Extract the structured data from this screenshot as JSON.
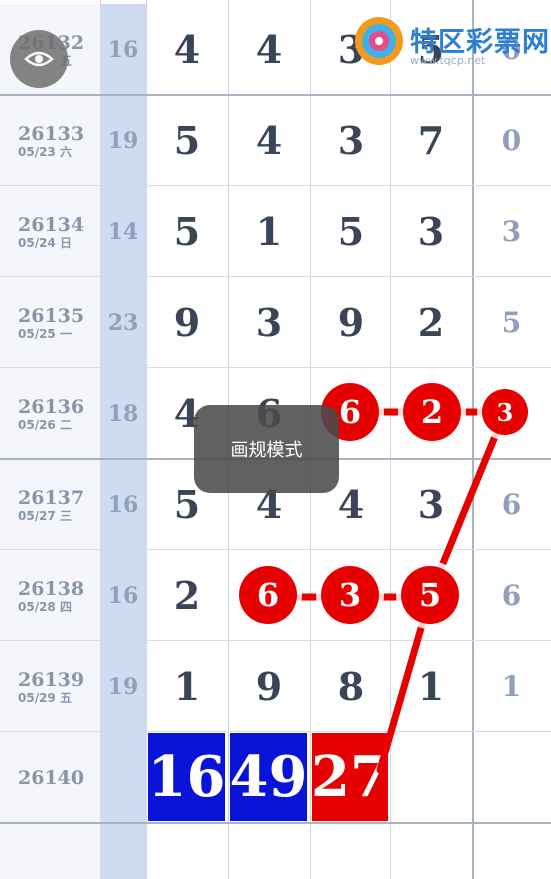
{
  "brand": {
    "name": "特区彩票网",
    "url": "www.tqcp.net"
  },
  "toast": {
    "text": "画规模式"
  },
  "eye_button": {
    "icon": "eye-icon"
  },
  "rows": [
    {
      "issue": "26132",
      "date": "五",
      "sum": "16",
      "digits": [
        "4",
        "4",
        "3",
        "5"
      ],
      "last": "0"
    },
    {
      "issue": "26133",
      "date": "05/23 六",
      "sum": "19",
      "digits": [
        "5",
        "4",
        "3",
        "7"
      ],
      "last": "0"
    },
    {
      "issue": "26134",
      "date": "05/24 日",
      "sum": "14",
      "digits": [
        "5",
        "1",
        "5",
        "3"
      ],
      "last": "3"
    },
    {
      "issue": "26135",
      "date": "05/25 一",
      "sum": "23",
      "digits": [
        "9",
        "3",
        "9",
        "2"
      ],
      "last": "5"
    },
    {
      "issue": "26136",
      "date": "05/26 二",
      "sum": "18",
      "digits": [
        "4",
        "6",
        "6",
        "2"
      ],
      "last": "3"
    },
    {
      "issue": "26137",
      "date": "05/27 三",
      "sum": "16",
      "digits": [
        "5",
        "4",
        "4",
        "3"
      ],
      "last": "6"
    },
    {
      "issue": "26138",
      "date": "05/28 四",
      "sum": "16",
      "digits": [
        "2",
        "6",
        "3",
        "5"
      ],
      "last": "6"
    },
    {
      "issue": "26139",
      "date": "05/29 五",
      "sum": "19",
      "digits": [
        "1",
        "9",
        "8",
        "1"
      ],
      "last": "1"
    },
    {
      "issue": "26140",
      "date": "",
      "sum": "",
      "digits": [
        "",
        "",
        "",
        ""
      ],
      "last": ""
    }
  ],
  "results": [
    "16",
    "49",
    "27"
  ],
  "colors": {
    "ball": "#e60000",
    "result_blue": "#0a14d8",
    "result_red": "#e60000"
  }
}
